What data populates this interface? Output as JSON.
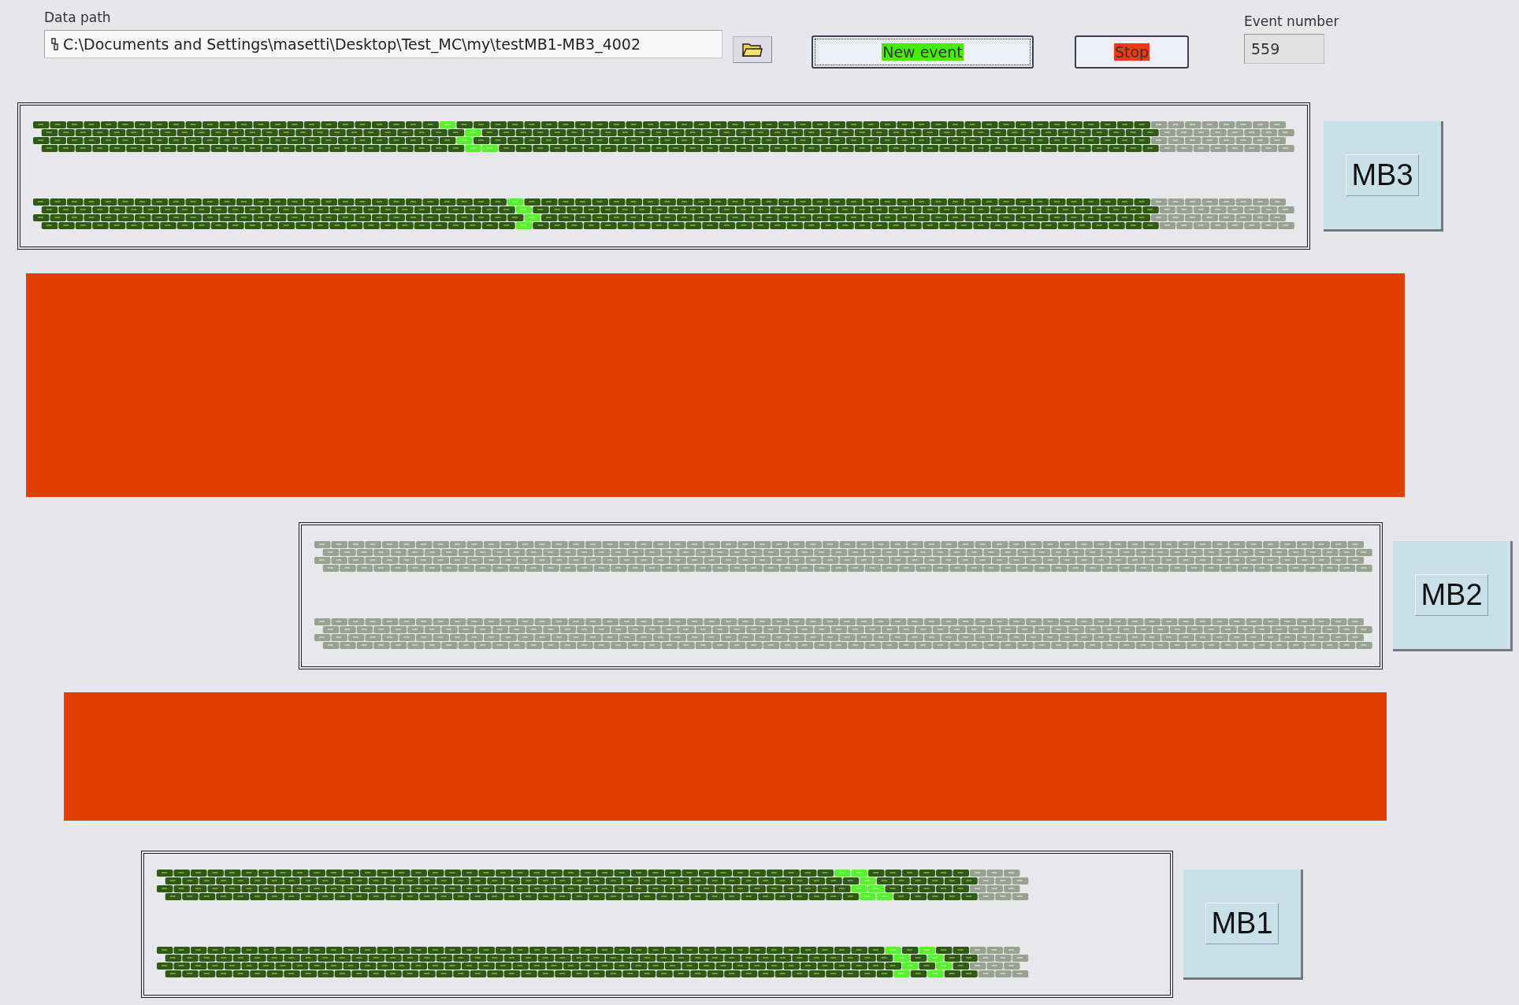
{
  "data_path": {
    "label": "Data path",
    "value": "C:\\Documents and Settings\\masetti\\Desktop\\Test_MC\\my\\testMB1-MB3_4002"
  },
  "buttons": [
    {
      "label": "New event",
      "kind": "go",
      "focused": true
    },
    {
      "label": "Stop",
      "kind": "stop",
      "focused": false
    }
  ],
  "event_number": {
    "label": "Event number",
    "value": "559"
  },
  "chambers": [
    {
      "label": "MB3",
      "active": true
    },
    {
      "label": "MB2",
      "active": false
    },
    {
      "label": "MB1",
      "active": true
    }
  ]
}
